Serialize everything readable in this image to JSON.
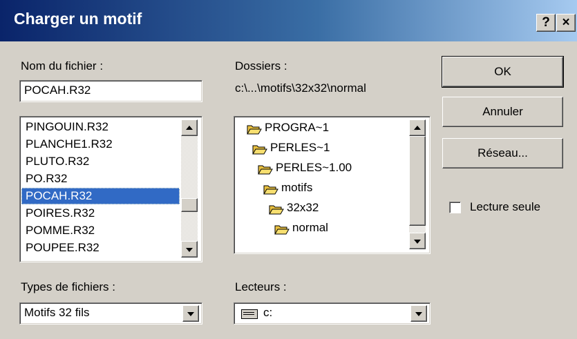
{
  "window": {
    "title": "Charger un motif",
    "help_label": "?",
    "close_label": "×"
  },
  "filename": {
    "label": "Nom du fichier :",
    "value": "POCAH.R32"
  },
  "files": [
    {
      "name": "PINGOUIN.R32",
      "selected": false
    },
    {
      "name": "PLANCHE1.R32",
      "selected": false
    },
    {
      "name": "PLUTO.R32",
      "selected": false
    },
    {
      "name": "PO.R32",
      "selected": false
    },
    {
      "name": "POCAH.R32",
      "selected": true
    },
    {
      "name": "POIRES.R32",
      "selected": false
    },
    {
      "name": "POMME.R32",
      "selected": false
    },
    {
      "name": "POUPEE.R32",
      "selected": false
    }
  ],
  "folders": {
    "label": "Dossiers :",
    "path": "c:\\...\\motifs\\32x32\\normal",
    "items": [
      {
        "name": "PROGRA~1",
        "open": true
      },
      {
        "name": "PERLES~1",
        "open": true
      },
      {
        "name": "PERLES~1.00",
        "open": true
      },
      {
        "name": "motifs",
        "open": true
      },
      {
        "name": "32x32",
        "open": true
      },
      {
        "name": "normal",
        "open": true,
        "current": true
      }
    ]
  },
  "buttons": {
    "ok": "OK",
    "cancel": "Annuler",
    "network": "Réseau..."
  },
  "readonly": {
    "label": "Lecture seule",
    "checked": false
  },
  "filetypes": {
    "label": "Types de fichiers :",
    "value": "Motifs 32 fils"
  },
  "drives": {
    "label": "Lecteurs :",
    "value": "c:",
    "icon": "hard-drive-icon"
  },
  "colors": {
    "titlebar_start": "#0a246a",
    "titlebar_end": "#a6caf0",
    "selection": "#316ac5",
    "face": "#d4d0c8"
  }
}
